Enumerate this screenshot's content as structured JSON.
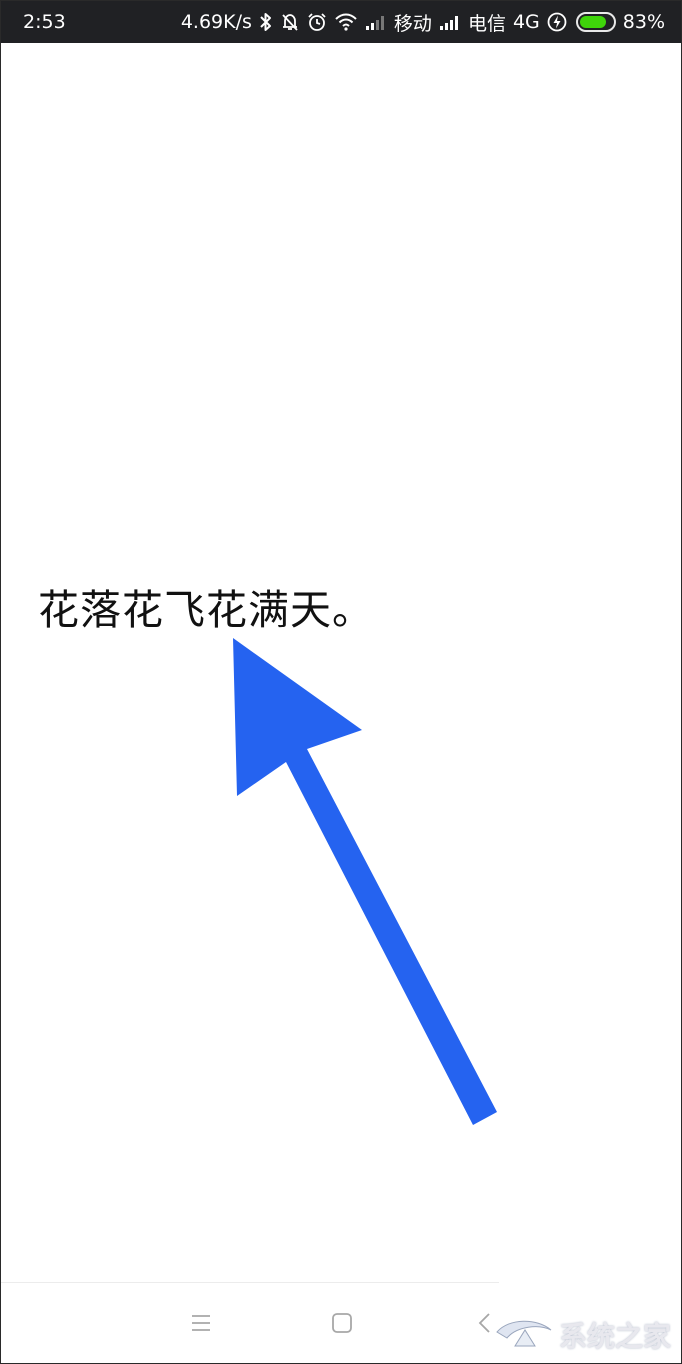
{
  "status_bar": {
    "time": "2:53",
    "net_speed": "4.69K/s",
    "carrier1": "移动",
    "carrier2": "电信",
    "network_type": "4G",
    "battery_percent": "83%",
    "battery_level": 0.83,
    "battery_color": "#3fd40a",
    "icons": [
      "bluetooth-icon",
      "bell-muted-icon",
      "alarm-icon",
      "wifi-icon",
      "signal-icon",
      "signal-icon",
      "charging-icon",
      "battery-icon"
    ]
  },
  "content": {
    "text": "花落花飞花满天。",
    "arrow_color": "#2563f0"
  },
  "nav_bar": {
    "icons": [
      "menu-icon",
      "home-icon",
      "back-icon"
    ]
  },
  "watermark": {
    "text": "系统之家"
  }
}
